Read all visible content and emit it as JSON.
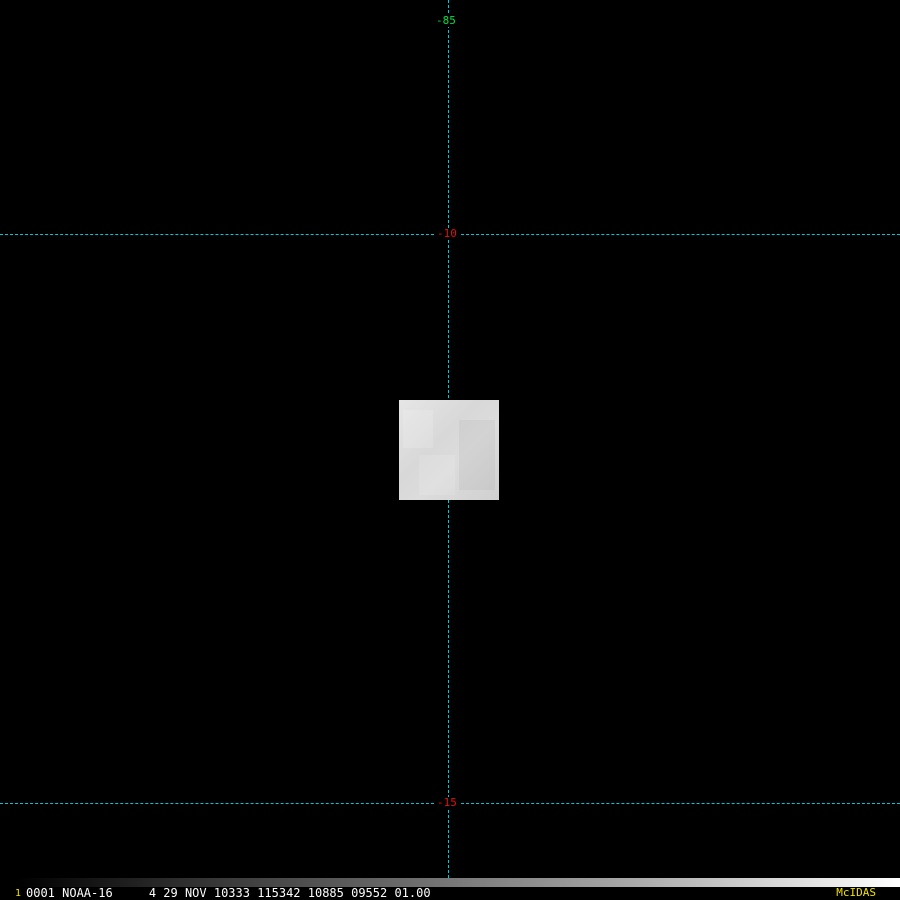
{
  "colors": {
    "background": "#000000",
    "grid_line": "#00c8d8",
    "longitude_label": "#00e040",
    "latitude_label": "#e01010",
    "status_text": "#ffffff",
    "frame_number": "#f0e000",
    "brand": "#f0e000"
  },
  "map": {
    "longitude_label": "-85",
    "latitude_labels": [
      "-10",
      "-15"
    ]
  },
  "status_bar": {
    "frame_number": "1",
    "text": "0001 NOAA-16     4 29 NOV 10333 115342 10885 09552 01.00",
    "brand": "McIDAS"
  }
}
